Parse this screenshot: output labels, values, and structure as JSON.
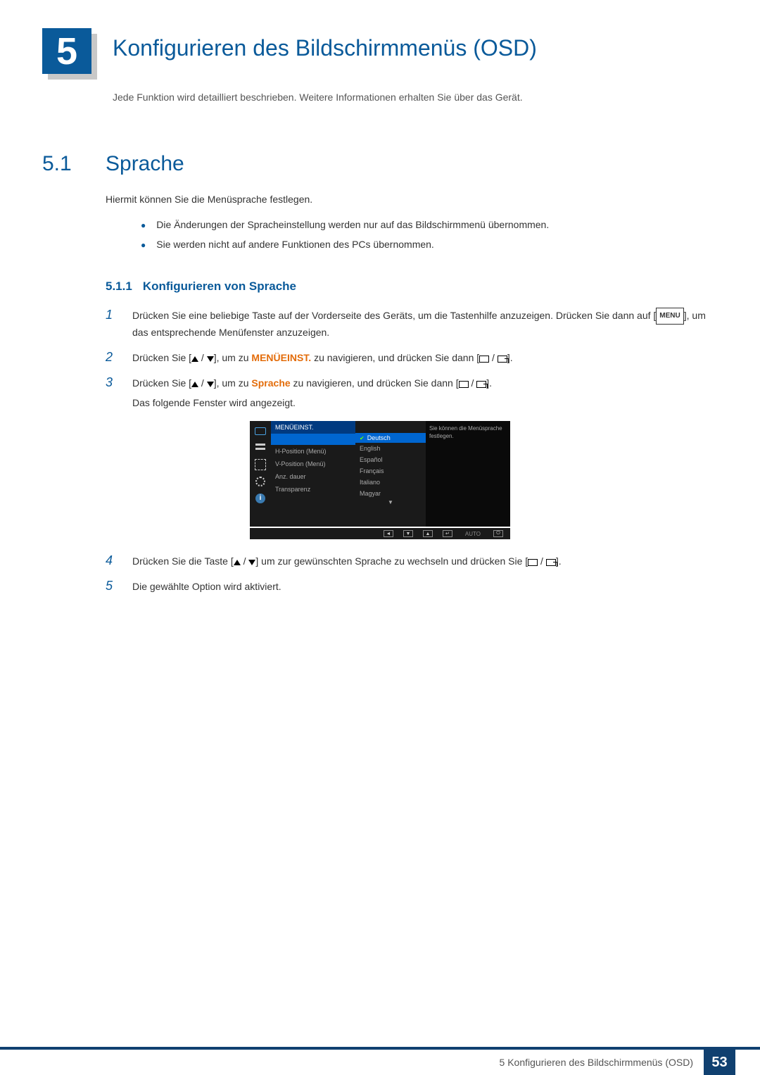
{
  "chapter": {
    "number": "5",
    "title": "Konfigurieren des Bildschirmmenüs (OSD)",
    "intro": "Jede Funktion wird detailliert beschrieben. Weitere Informationen erhalten Sie über das Gerät."
  },
  "section": {
    "number": "5.1",
    "title": "Sprache",
    "intro": "Hiermit können Sie die Menüsprache festlegen.",
    "bullets": [
      "Die Änderungen der Spracheinstellung werden nur auf das Bildschirmmenü übernommen.",
      "Sie werden nicht auf andere Funktionen des PCs übernommen."
    ]
  },
  "subsection": {
    "number": "5.1.1",
    "title": "Konfigurieren von Sprache"
  },
  "steps": {
    "s1a": "Drücken Sie eine beliebige Taste auf der Vorderseite des Geräts, um die Tastenhilfe anzuzeigen. Drücken Sie dann auf [",
    "s1b": "], um das entsprechende Menüfenster anzuzeigen.",
    "s2a": "Drücken Sie [",
    "s2b": "], um zu ",
    "s2hl": "MENÜEINST.",
    "s2c": " zu navigieren, und drücken Sie dann [",
    "s2d": "].",
    "s3a": "Drücken Sie [",
    "s3b": "], um zu ",
    "s3hl": "Sprache",
    "s3c": " zu navigieren, und drücken Sie dann [",
    "s3d": "].",
    "s3e": "Das folgende Fenster wird angezeigt.",
    "s4a": "Drücken Sie die Taste [",
    "s4b": "] um zur gewünschten Sprache zu wechseln und drücken Sie [",
    "s4c": "].",
    "s5": "Die gewählte Option wird aktiviert."
  },
  "menu_label": "MENU",
  "osd": {
    "header": "MENÜEINST.",
    "left": [
      "H-Position (Menü)",
      "V-Position (Menü)",
      "Anz. dauer",
      "Transparenz"
    ],
    "mid_selected": "Deutsch",
    "mid": [
      "English",
      "Español",
      "Français",
      "Italiano",
      "Magyar"
    ],
    "right": "Sie können die Menüsprache festlegen.",
    "bar_auto": "AUTO",
    "info_glyph": "i"
  },
  "footer": {
    "text": "5 Konfigurieren des Bildschirmmenüs (OSD)",
    "page": "53"
  }
}
